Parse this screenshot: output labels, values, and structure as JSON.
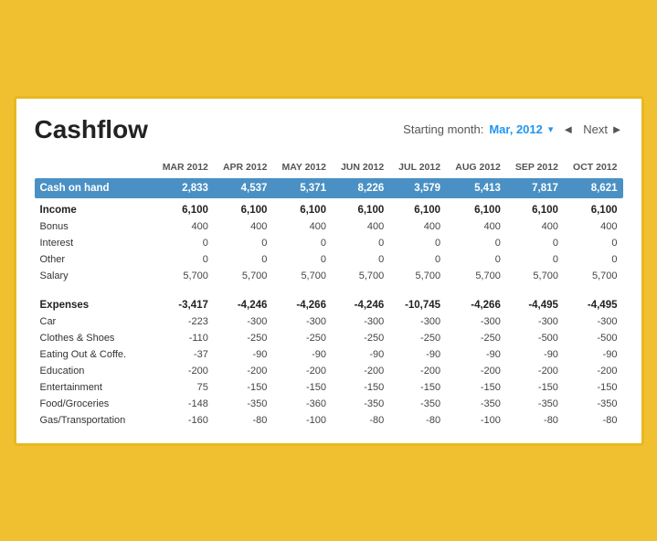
{
  "header": {
    "title": "Cashflow",
    "starting_month_label": "Starting month:",
    "starting_month_value": "Mar, 2012",
    "prev_label": "◄",
    "next_label": "Next ►"
  },
  "columns": [
    "",
    "MAR 2012",
    "APR 2012",
    "MAY 2012",
    "JUN 2012",
    "JUL 2012",
    "AUG 2012",
    "SEP 2012",
    "OCT 2012"
  ],
  "cash_on_hand": {
    "label": "Cash on hand",
    "values": [
      "2,833",
      "4,537",
      "5,371",
      "8,226",
      "3,579",
      "5,413",
      "7,817",
      "8,621"
    ]
  },
  "income": {
    "label": "Income",
    "total": [
      "6,100",
      "6,100",
      "6,100",
      "6,100",
      "6,100",
      "6,100",
      "6,100",
      "6,100"
    ],
    "rows": [
      {
        "label": "Bonus",
        "values": [
          "400",
          "400",
          "400",
          "400",
          "400",
          "400",
          "400",
          "400"
        ]
      },
      {
        "label": "Interest",
        "values": [
          "0",
          "0",
          "0",
          "0",
          "0",
          "0",
          "0",
          "0"
        ]
      },
      {
        "label": "Other",
        "values": [
          "0",
          "0",
          "0",
          "0",
          "0",
          "0",
          "0",
          "0"
        ]
      },
      {
        "label": "Salary",
        "values": [
          "5,700",
          "5,700",
          "5,700",
          "5,700",
          "5,700",
          "5,700",
          "5,700",
          "5,700"
        ]
      }
    ]
  },
  "expenses": {
    "label": "Expenses",
    "total": [
      "-3,417",
      "-4,246",
      "-4,266",
      "-4,246",
      "-10,745",
      "-4,266",
      "-4,495",
      "-4,495"
    ],
    "rows": [
      {
        "label": "Car",
        "values": [
          "-223",
          "-300",
          "-300",
          "-300",
          "-300",
          "-300",
          "-300",
          "-300"
        ]
      },
      {
        "label": "Clothes & Shoes",
        "values": [
          "-110",
          "-250",
          "-250",
          "-250",
          "-250",
          "-250",
          "-500",
          "-500"
        ]
      },
      {
        "label": "Eating Out & Coffe.",
        "values": [
          "-37",
          "-90",
          "-90",
          "-90",
          "-90",
          "-90",
          "-90",
          "-90"
        ]
      },
      {
        "label": "Education",
        "values": [
          "-200",
          "-200",
          "-200",
          "-200",
          "-200",
          "-200",
          "-200",
          "-200"
        ]
      },
      {
        "label": "Entertainment",
        "values": [
          "75",
          "-150",
          "-150",
          "-150",
          "-150",
          "-150",
          "-150",
          "-150"
        ]
      },
      {
        "label": "Food/Groceries",
        "values": [
          "-148",
          "-350",
          "-360",
          "-350",
          "-350",
          "-350",
          "-350",
          "-350"
        ]
      },
      {
        "label": "Gas/Transportation",
        "values": [
          "-160",
          "-80",
          "-100",
          "-80",
          "-80",
          "-100",
          "-80",
          "-80"
        ]
      }
    ]
  }
}
